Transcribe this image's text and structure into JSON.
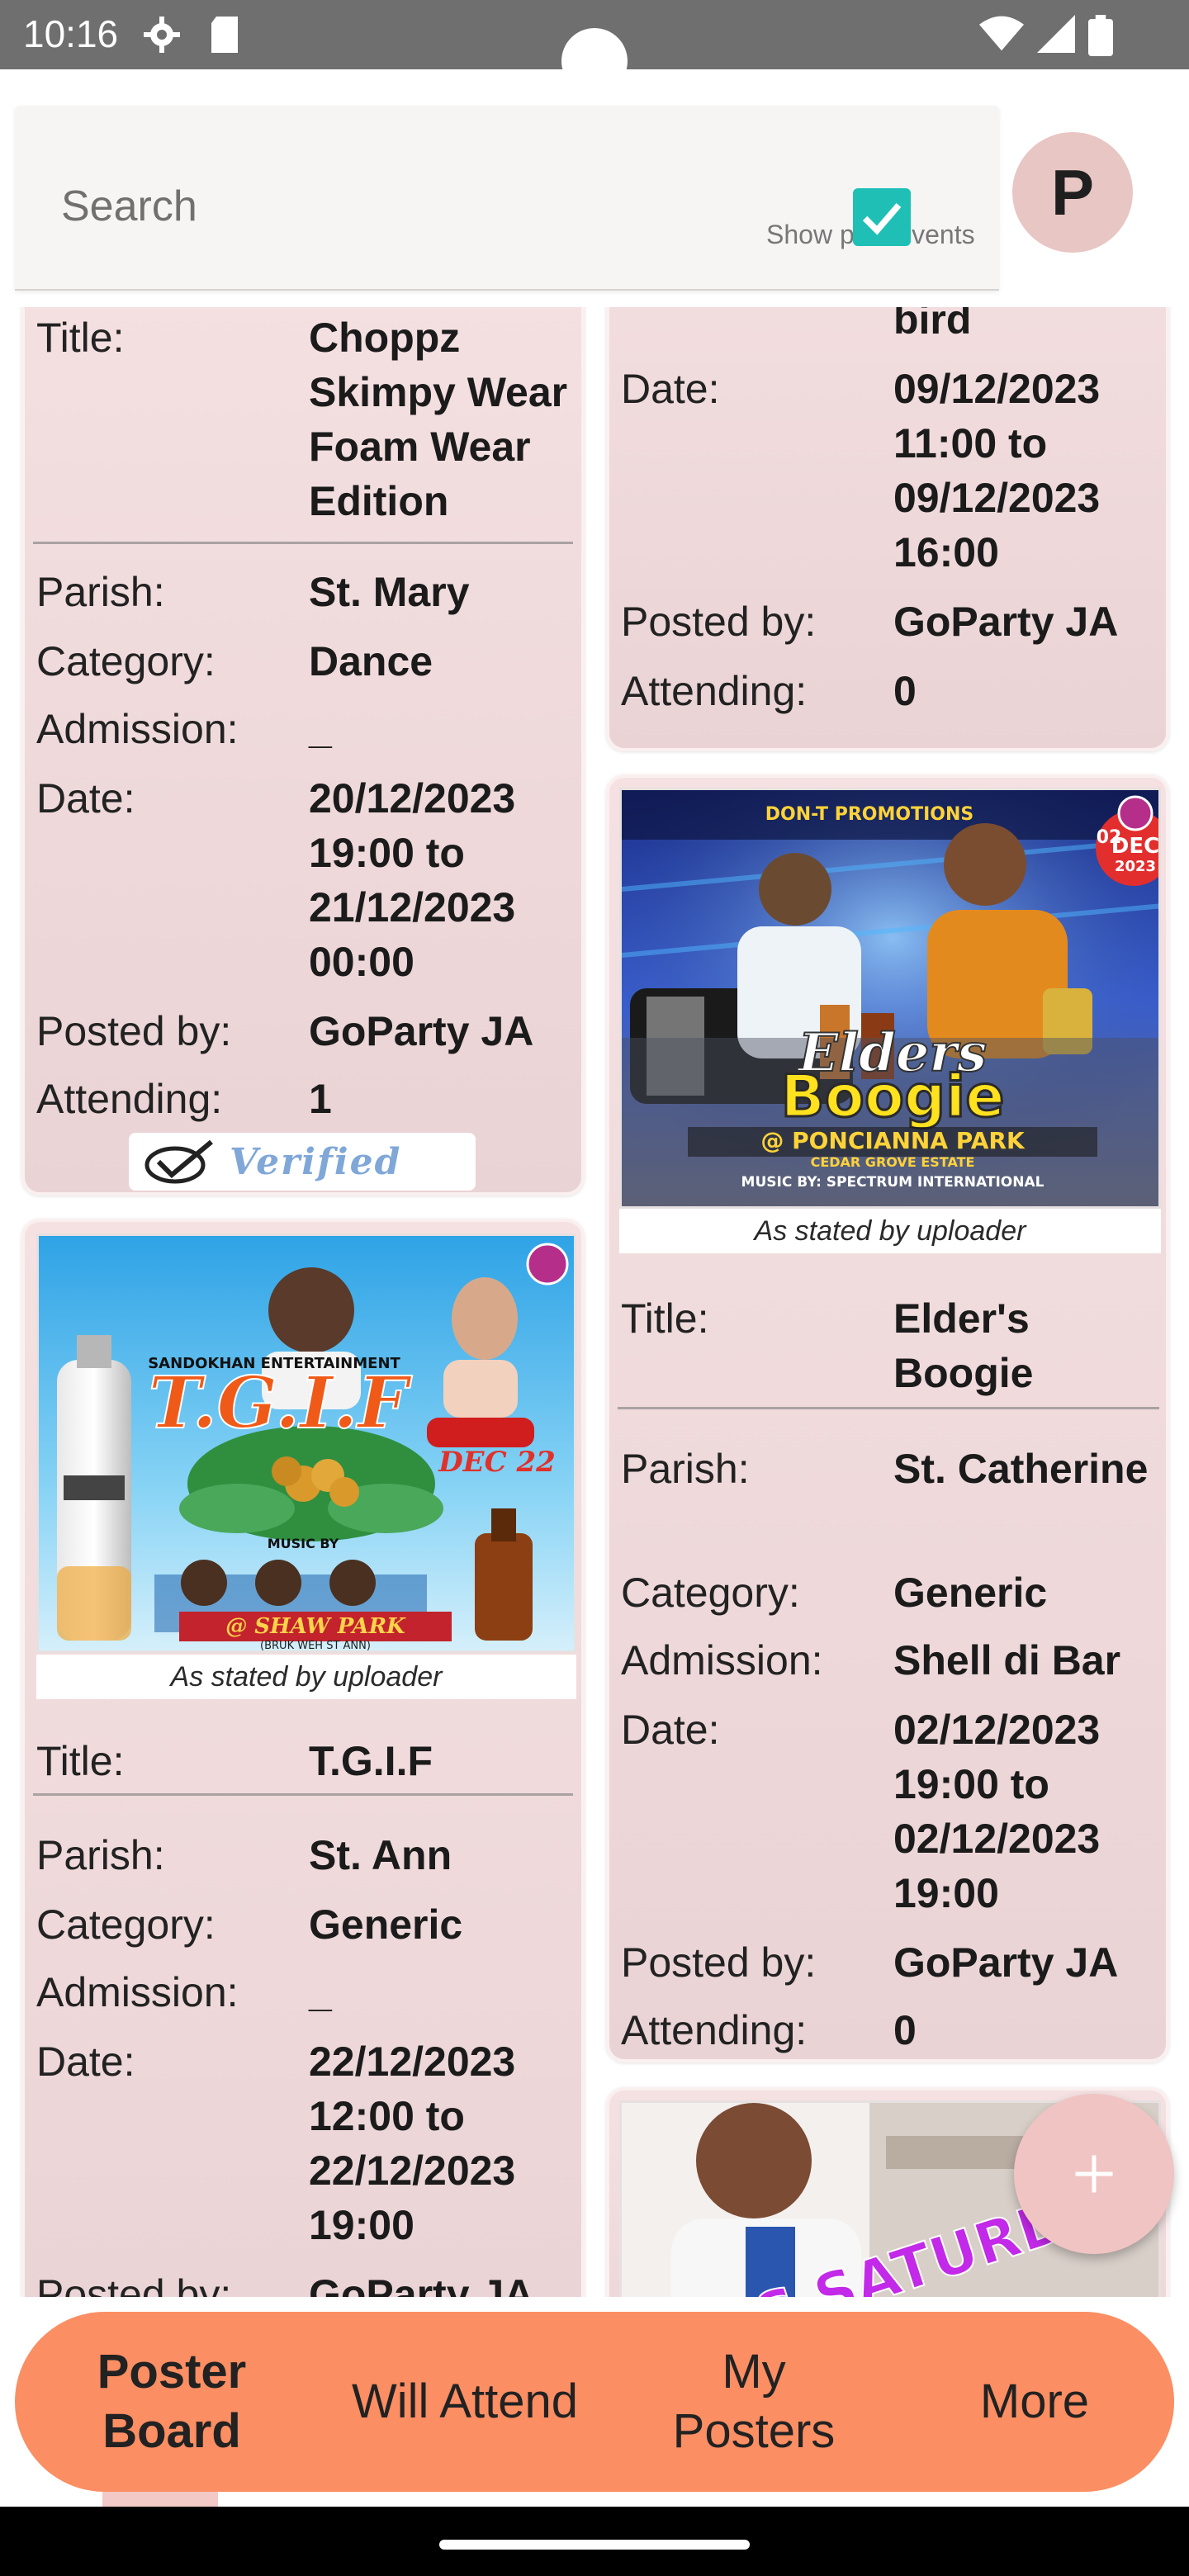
{
  "status_bar": {
    "time": "10:16"
  },
  "search": {
    "placeholder": "Search",
    "show_past_label": "Show past events",
    "show_past_checked": true
  },
  "profile": {
    "initial": "P"
  },
  "labels": {
    "title": "Title:",
    "parish": "Parish:",
    "category": "Category:",
    "admission": "Admission:",
    "date": "Date:",
    "posted_by": "Posted by:",
    "attending": "Attending:",
    "caption": "As stated by uploader",
    "verified": "Verified"
  },
  "events": {
    "left1": {
      "title": "Choppz Skimpy Wear Foam Wear Edition",
      "parish": "St. Mary",
      "category": "Dance",
      "admission": "_",
      "date": "20/12/2023 19:00 to 21/12/2023 00:00",
      "posted_by": "GoParty JA",
      "attending": "1",
      "verified": true
    },
    "left2": {
      "title": "T.G.I.F",
      "parish": "St. Ann",
      "category": "Generic",
      "admission": "_",
      "date": "22/12/2023 12:00 to 22/12/2023 19:00",
      "posted_by": "GoParty JA",
      "poster_text": {
        "promoter": "SANDOKHAN ENTERTAINMENT",
        "headline": "T.G.I.F",
        "date": "DEC 22",
        "music_by": "MUSIC BY",
        "venue": "@ SHAW PARK",
        "venue_sub": "(BRUK WEH ST ANN)"
      }
    },
    "right1": {
      "title_tail": "bird",
      "date": "09/12/2023 11:00 to 09/12/2023 16:00",
      "posted_by": "GoParty JA",
      "attending": "0"
    },
    "right2": {
      "title": "Elder's Boogie",
      "parish": "St. Catherine",
      "category": "Generic",
      "admission": "Shell di Bar",
      "date": "02/12/2023 19:00 to 02/12/2023 19:00",
      "posted_by": "GoParty JA",
      "attending": "0",
      "poster_text": {
        "promoter": "DON-T PROMOTIONS",
        "headline_1": "Elders",
        "headline_2": "Boogie",
        "venue": "@ PONCIANNA PARK",
        "venue_sub": "CEDAR GROVE ESTATE",
        "music": "MUSIC BY: SPECTRUM INTERNATIONAL",
        "date_day": "02",
        "date_month": "DEC",
        "date_year": "2023"
      }
    },
    "right3": {
      "poster_text": {
        "headline": "THIS SATURD"
      }
    }
  },
  "nav": {
    "items": [
      {
        "label": "Poster Board",
        "active": true
      },
      {
        "label": "Will Attend",
        "active": false
      },
      {
        "label": "My Posters",
        "active": false
      },
      {
        "label": "More",
        "active": false
      }
    ]
  },
  "colors": {
    "accent": "#fb8e63",
    "card": "#f2dcdd",
    "checkbox": "#1fbfb5",
    "avatar": "#e8c6c4",
    "fab": "#f0c4c3"
  }
}
